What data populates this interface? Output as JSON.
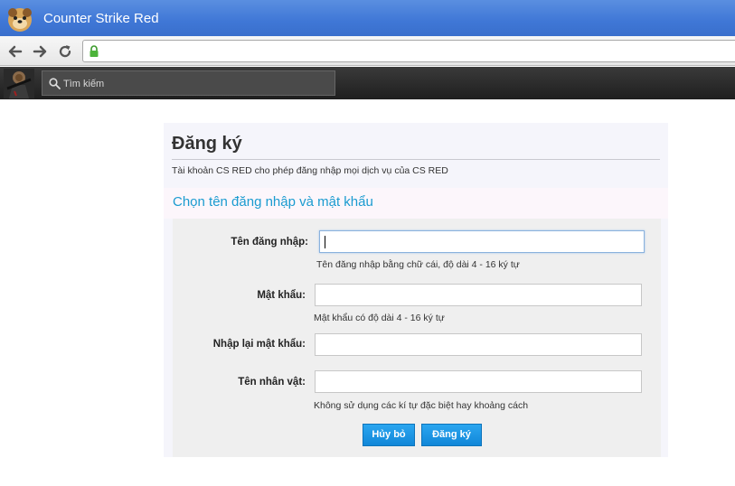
{
  "browser": {
    "title": "Counter Strike Red"
  },
  "sitebar": {
    "search_placeholder": "Tìm kiếm"
  },
  "form": {
    "heading": "Đăng ký",
    "description": "Tài khoản CS RED cho phép đăng nhập mọi dịch vụ của CS RED",
    "section_title": "Chọn tên đăng nhập và mật khẩu",
    "fields": [
      {
        "label": "Tên đăng nhập:",
        "value": "",
        "hint": "Tên đăng nhập bằng chữ cái, độ dài 4 - 16 ký tự"
      },
      {
        "label": "Mật khẩu:",
        "value": "",
        "hint": "Mật khẩu có độ dài 4 - 16 ký tự"
      },
      {
        "label": "Nhập lại mật khẩu:",
        "value": "",
        "hint": ""
      },
      {
        "label": "Tên nhân vật:",
        "value": "",
        "hint": "Không sử dụng các kí tự đặc biệt hay khoảng cách"
      }
    ],
    "cancel_label": "Hủy bỏ",
    "submit_label": "Đăng ký"
  },
  "colors": {
    "accent": "#1a9bd0",
    "button": "#1187d8",
    "titlebar": "#3f77d6"
  },
  "icons": [
    "back-arrow-icon",
    "forward-arrow-icon",
    "reload-icon",
    "lock-icon",
    "search-icon"
  ]
}
